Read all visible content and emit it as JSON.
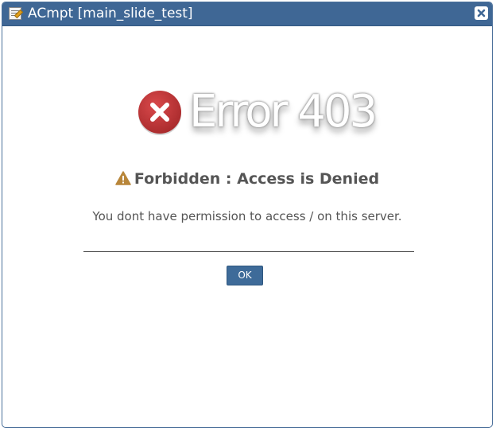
{
  "window": {
    "title": "ACmpt [main_slide_test]",
    "app_icon": "notepad-icon",
    "close_icon": "close-icon"
  },
  "error": {
    "icon": "error-x-circle-icon",
    "code_text": "Error 403",
    "heading": "Forbidden : Access is Denied",
    "heading_icon": "warning-triangle-icon",
    "message": "You dont have permission to access / on this server."
  },
  "actions": {
    "ok_label": "OK"
  },
  "colors": {
    "titlebar": "#3f6795",
    "error_red": "#c0393b",
    "warning": "#b8863a",
    "button": "#3e6b99",
    "text": "#555555"
  }
}
